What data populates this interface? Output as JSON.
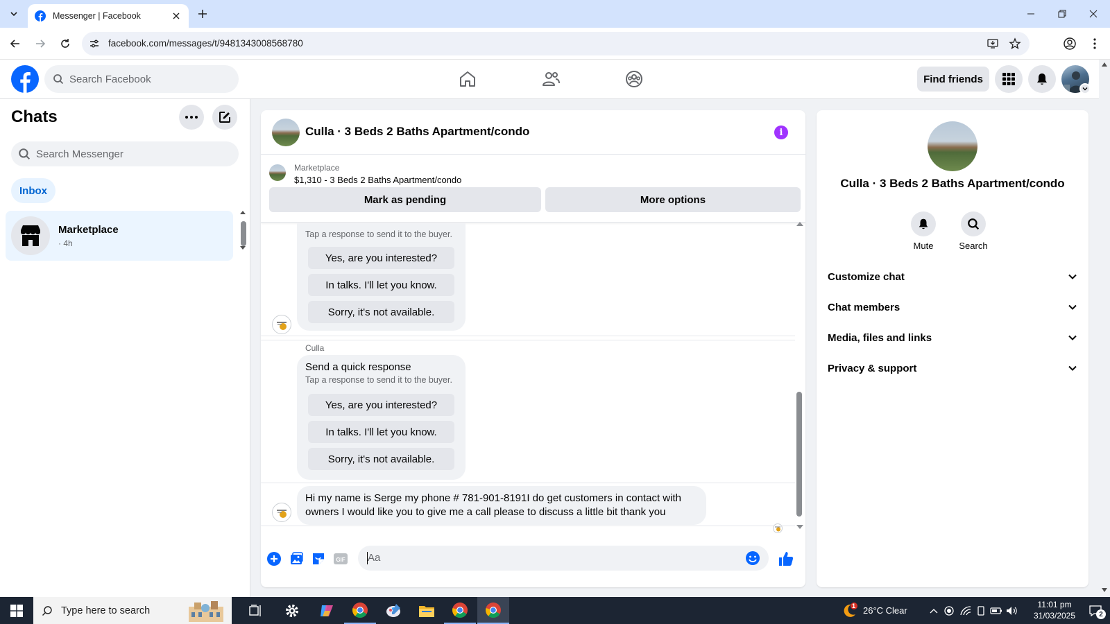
{
  "browser": {
    "tab_title": "Messenger | Facebook",
    "url": "facebook.com/messages/t/9481343008568780"
  },
  "fb": {
    "search_placeholder": "Search Facebook",
    "find_friends": "Find friends",
    "brand_color": "#0866ff"
  },
  "left": {
    "title": "Chats",
    "search_placeholder": "Search Messenger",
    "inbox_label": "Inbox",
    "conversations": [
      {
        "name": "Marketplace",
        "time": "· 4h"
      }
    ]
  },
  "conversation": {
    "title": "Culla · 3 Beds 2 Baths Apartment/condo",
    "marketplace_label": "Marketplace",
    "listing_price_title": "$1,310 - 3 Beds 2 Baths Apartment/condo",
    "mark_pending": "Mark as pending",
    "more_options": "More options",
    "quick_card_1": {
      "subtitle": "Tap a response to send it to the buyer.",
      "responses": [
        "Yes, are you interested?",
        "In talks. I'll let you know.",
        "Sorry, it's not available."
      ]
    },
    "sender_name": "Culla",
    "quick_card_2": {
      "heading": "Send a quick response",
      "subtitle": "Tap a response to send it to the buyer.",
      "responses": [
        "Yes, are you interested?",
        "In talks. I'll let you know.",
        "Sorry, it's not available."
      ]
    },
    "message_text": "Hi my name is Serge my phone # 781-901-8191I do get customers in contact with owners I would like you to give me a call please to discuss a little bit thank you",
    "composer_placeholder": "Aa"
  },
  "info_panel": {
    "name": "Culla · 3 Beds 2 Baths Apartment/condo",
    "actions": [
      "Mute",
      "Search"
    ],
    "sections": [
      "Customize chat",
      "Chat members",
      "Media, files and links",
      "Privacy & support"
    ]
  },
  "taskbar": {
    "search_placeholder": "Type here to search",
    "weather": "26°C  Clear",
    "time": "11:01 pm",
    "date": "31/03/2025",
    "notification_count": "2",
    "weather_badge": "1"
  }
}
